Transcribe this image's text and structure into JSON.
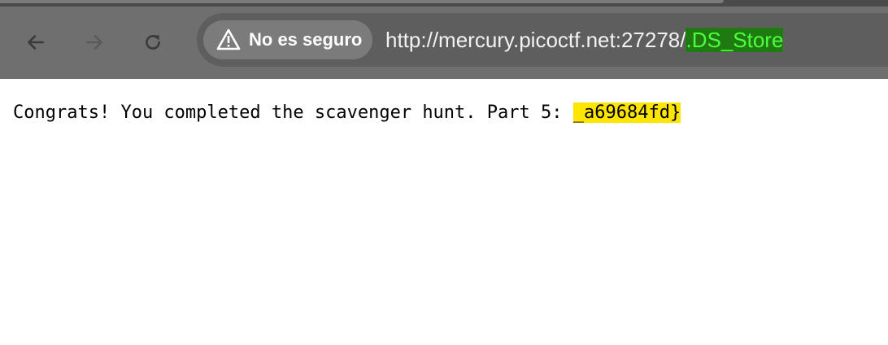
{
  "browser": {
    "back_icon": "arrow-left-icon",
    "forward_icon": "arrow-right-icon",
    "reload_icon": "reload-icon",
    "security_icon": "warning-triangle-icon",
    "security_label": "No es seguro",
    "url_base": "http://mercury.picoctf.net:27278/",
    "url_highlight": ".DS_Store"
  },
  "page": {
    "message": "Congrats! You completed the scavenger hunt. Part 5: ",
    "flag_part": "_a69684fd}"
  },
  "colors": {
    "flag_highlight": "#ffe600",
    "url_highlight_bg": "#1f7a12",
    "url_highlight_fg": "#4dff3c"
  }
}
